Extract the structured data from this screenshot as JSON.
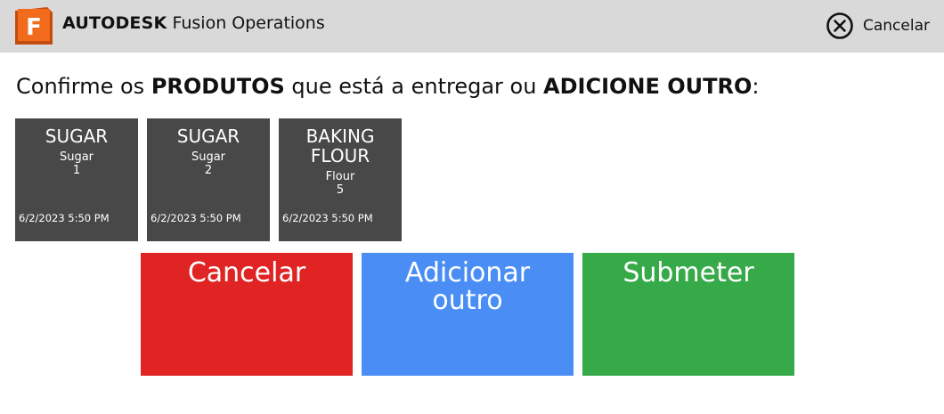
{
  "header": {
    "brand_name": "AUTODESK",
    "product_name": "Fusion Operations",
    "logo_letter": "F",
    "cancel_label": "Cancelar"
  },
  "instruction": {
    "part1": "Confirme os ",
    "bold1": "PRODUTOS",
    "part2": " que está a entregar ou ",
    "bold2": "ADICIONE OUTRO",
    "part3": ":"
  },
  "products": [
    {
      "name": "SUGAR",
      "subtitle": "Sugar",
      "quantity": "1",
      "date": "6/2/2023 5:50 PM"
    },
    {
      "name": "SUGAR",
      "subtitle": "Sugar",
      "quantity": "2",
      "date": "6/2/2023 5:50 PM"
    },
    {
      "name_line1": "BAKING",
      "name_line2": "FLOUR",
      "subtitle": "Flour",
      "quantity": "5",
      "date": "6/2/2023 5:50 PM"
    }
  ],
  "actions": {
    "cancel_label": "Cancelar",
    "add_line1": "Adicionar",
    "add_line2": "outro",
    "submit_label": "Submeter"
  },
  "colors": {
    "header_bg": "#d9d9d9",
    "tile_bg": "#484848",
    "cancel": "#e02424",
    "add": "#4a8ef5",
    "submit": "#36aa49",
    "logo": "#f26a1b"
  }
}
